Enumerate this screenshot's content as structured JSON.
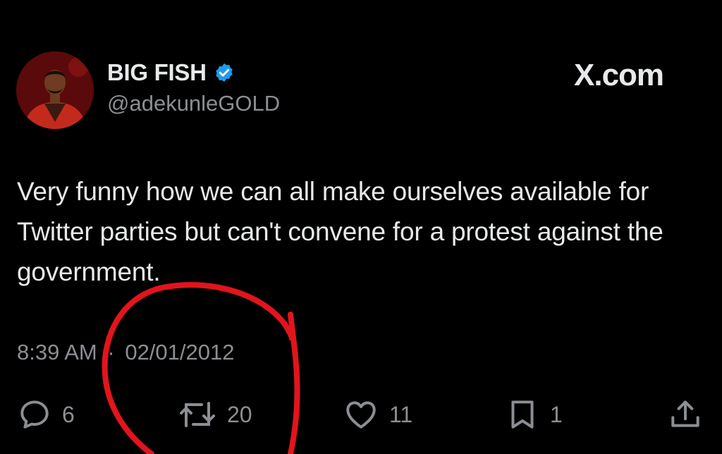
{
  "author": {
    "display_name": "BIG FISH",
    "handle": "@adekunleGOLD",
    "avatar_icon": "profile-photo",
    "verified_icon": "verified-badge-icon",
    "verified_color": "#1d9bf0"
  },
  "site": {
    "logo": "X.com"
  },
  "tweet": {
    "text": "Very funny how we can all make ourselves available for Twitter parties but can't convene for a protest against the government.",
    "time": "8:39 AM",
    "separator": "·",
    "date": "02/01/2012"
  },
  "actions": {
    "replies": {
      "icon": "reply-icon",
      "count": "6"
    },
    "reposts": {
      "icon": "repost-icon",
      "count": "20"
    },
    "likes": {
      "icon": "like-icon",
      "count": "11"
    },
    "bookmarks": {
      "icon": "bookmark-icon",
      "count": "1"
    },
    "share": {
      "icon": "share-icon"
    }
  },
  "annotation": {
    "shape": "hand-drawn circle",
    "color": "#e3141b"
  }
}
